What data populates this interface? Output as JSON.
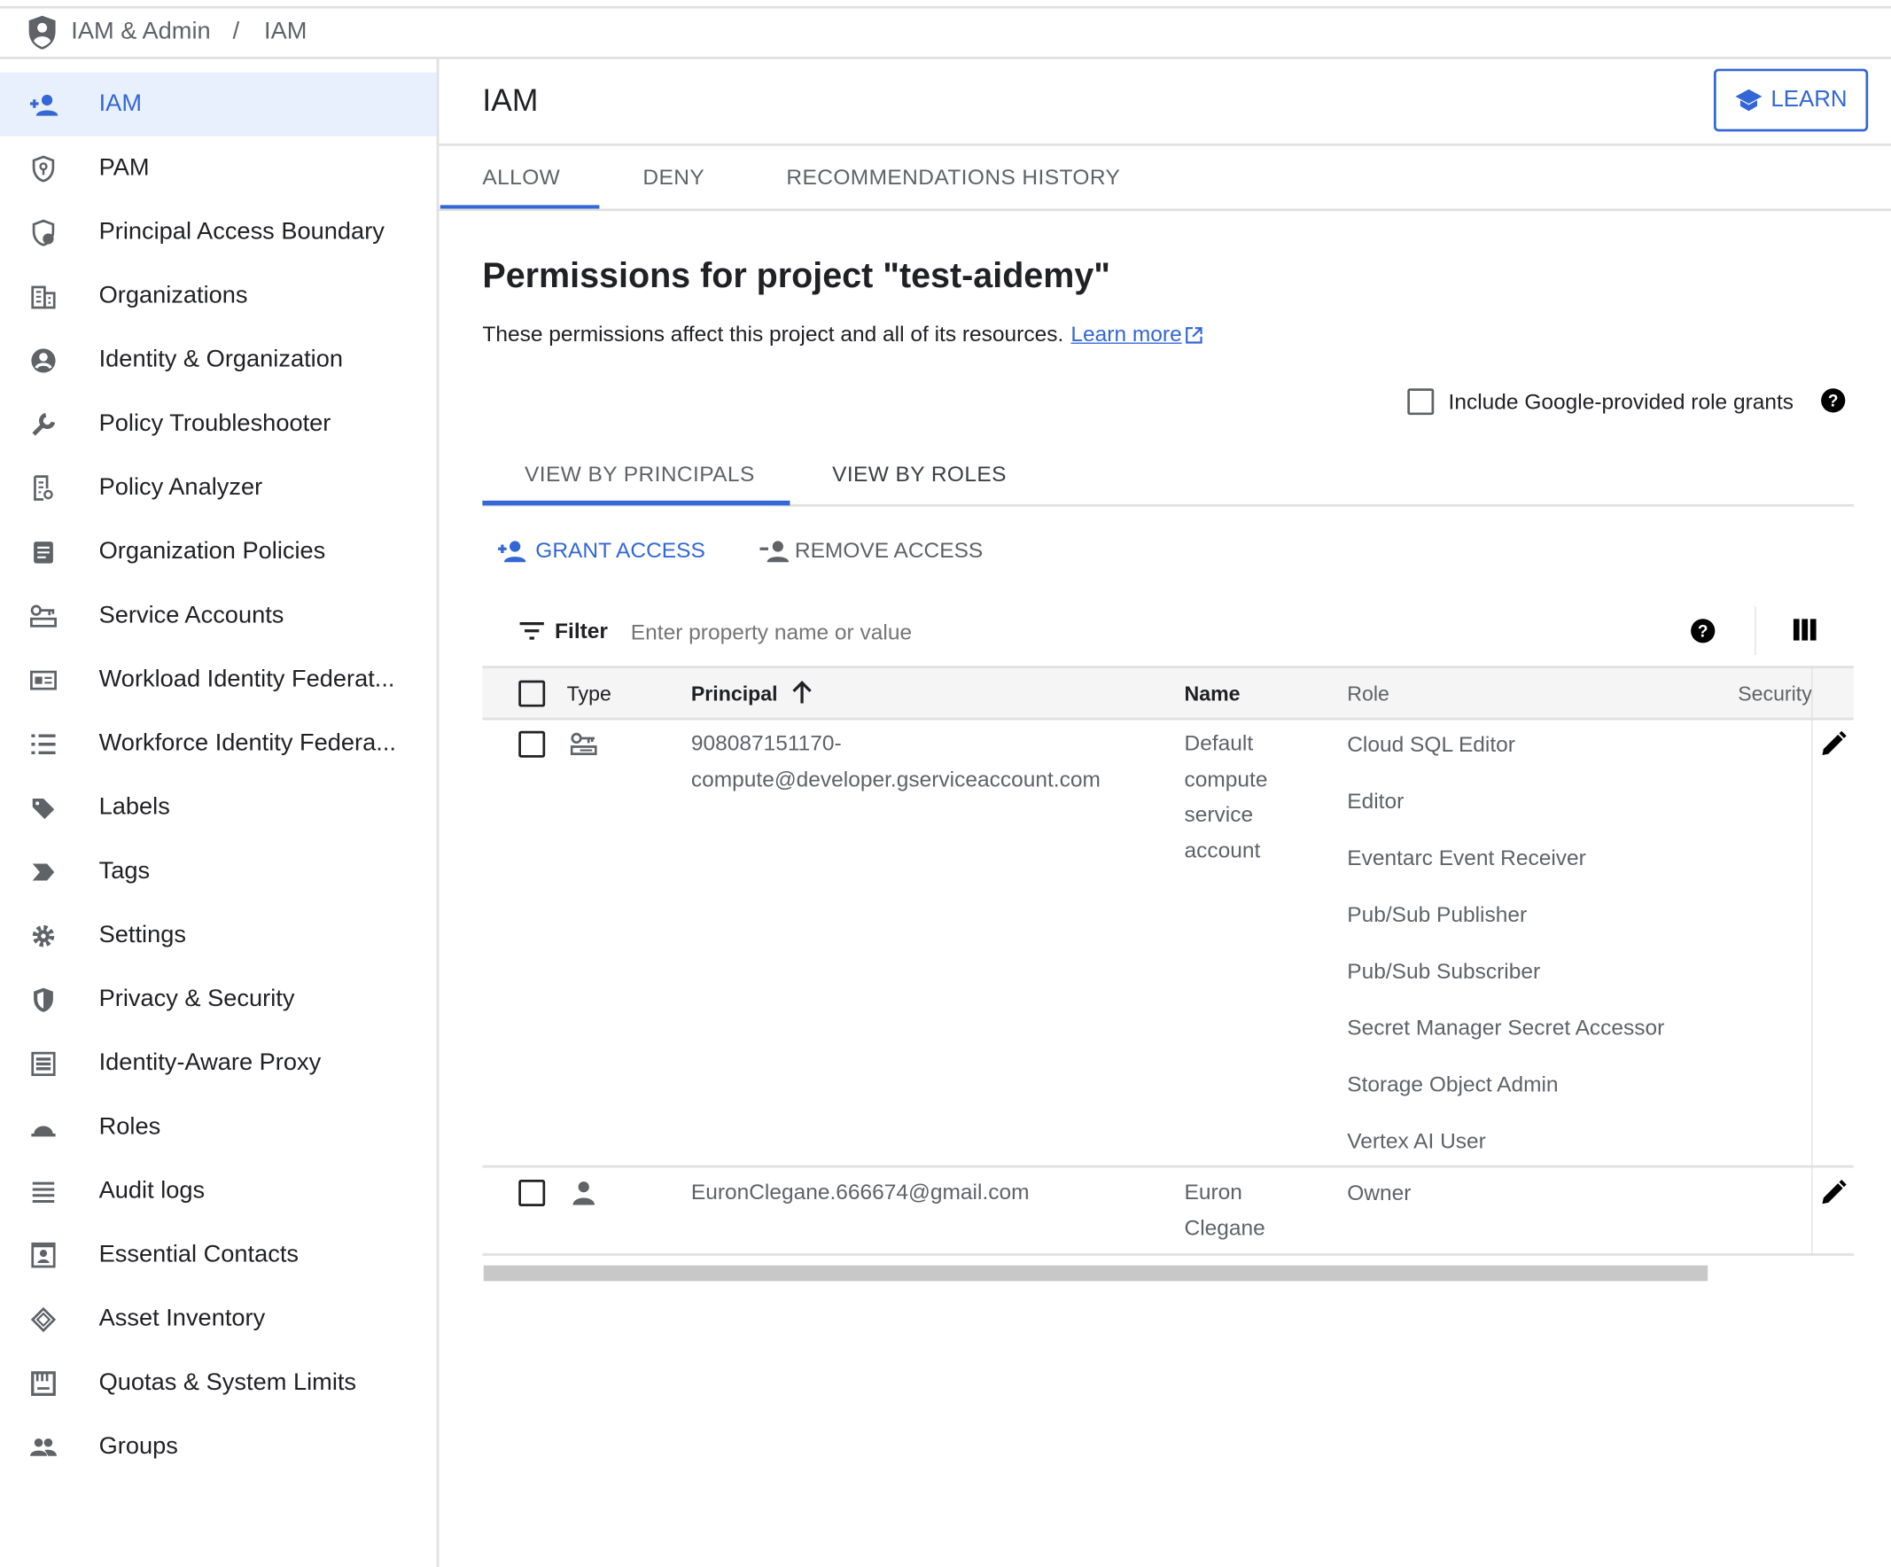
{
  "breadcrumb": {
    "section": "IAM & Admin",
    "separator": "/",
    "page": "IAM"
  },
  "sidebar": {
    "items": [
      {
        "label": "IAM",
        "icon": "person-add-icon",
        "selected": true
      },
      {
        "label": "PAM",
        "icon": "shield-key-icon"
      },
      {
        "label": "Principal Access Boundary",
        "icon": "shield-person-icon"
      },
      {
        "label": "Organizations",
        "icon": "building-icon"
      },
      {
        "label": "Identity & Organization",
        "icon": "account-circle-icon"
      },
      {
        "label": "Policy Troubleshooter",
        "icon": "wrench-icon"
      },
      {
        "label": "Policy Analyzer",
        "icon": "document-search-icon"
      },
      {
        "label": "Organization Policies",
        "icon": "list-document-icon"
      },
      {
        "label": "Service Accounts",
        "icon": "service-account-icon"
      },
      {
        "label": "Workload Identity Federat...",
        "icon": "id-card-icon"
      },
      {
        "label": "Workforce Identity Federa...",
        "icon": "list-icon"
      },
      {
        "label": "Labels",
        "icon": "label-icon"
      },
      {
        "label": "Tags",
        "icon": "tag-chevron-icon"
      },
      {
        "label": "Settings",
        "icon": "gear-icon"
      },
      {
        "label": "Privacy & Security",
        "icon": "shield-icon"
      },
      {
        "label": "Identity-Aware Proxy",
        "icon": "proxy-icon"
      },
      {
        "label": "Roles",
        "icon": "hat-icon"
      },
      {
        "label": "Audit logs",
        "icon": "lines-icon"
      },
      {
        "label": "Essential Contacts",
        "icon": "contact-card-icon"
      },
      {
        "label": "Asset Inventory",
        "icon": "layers-icon"
      },
      {
        "label": "Quotas & System Limits",
        "icon": "quota-icon"
      },
      {
        "label": "Groups",
        "icon": "group-icon"
      }
    ]
  },
  "header": {
    "title": "IAM",
    "learn_label": "LEARN"
  },
  "tabs": [
    {
      "label": "ALLOW",
      "active": true
    },
    {
      "label": "DENY"
    },
    {
      "label": "RECOMMENDATIONS HISTORY"
    }
  ],
  "main": {
    "title": "Permissions for project \"test-aidemy\"",
    "subtitle": "These permissions affect this project and all of its resources.",
    "learn_more": "Learn more",
    "include_google": "Include Google-provided role grants",
    "include_google_checked": false,
    "view_tabs": [
      {
        "label": "VIEW BY PRINCIPALS",
        "active": true
      },
      {
        "label": "VIEW BY ROLES"
      }
    ],
    "grant_access": "GRANT ACCESS",
    "remove_access": "REMOVE ACCESS",
    "filter_label": "Filter",
    "filter_placeholder": "Enter property name or value"
  },
  "table": {
    "columns": [
      "Type",
      "Principal",
      "Name",
      "Role",
      "Security"
    ],
    "sort": "Principal ascending",
    "rows": [
      {
        "type": "service-account",
        "principal_lines": [
          "908087151170-",
          "compute@developer.gserviceaccount.com"
        ],
        "name_lines": [
          "Default",
          "compute",
          "service",
          "account"
        ],
        "roles": [
          "Cloud SQL Editor",
          "Editor",
          "Eventarc Event Receiver",
          "Pub/Sub Publisher",
          "Pub/Sub Subscriber",
          "Secret Manager Secret Accessor",
          "Storage Object Admin",
          "Vertex AI User"
        ]
      },
      {
        "type": "user",
        "principal_lines": [
          "EuronClegane.666674@gmail.com"
        ],
        "name_lines": [
          "Euron",
          "Clegane"
        ],
        "roles": [
          "Owner"
        ]
      }
    ]
  },
  "colors": {
    "accent": "#3367d6",
    "selected_bg": "#e8f0fe",
    "header_bg": "#f5f5f5"
  }
}
